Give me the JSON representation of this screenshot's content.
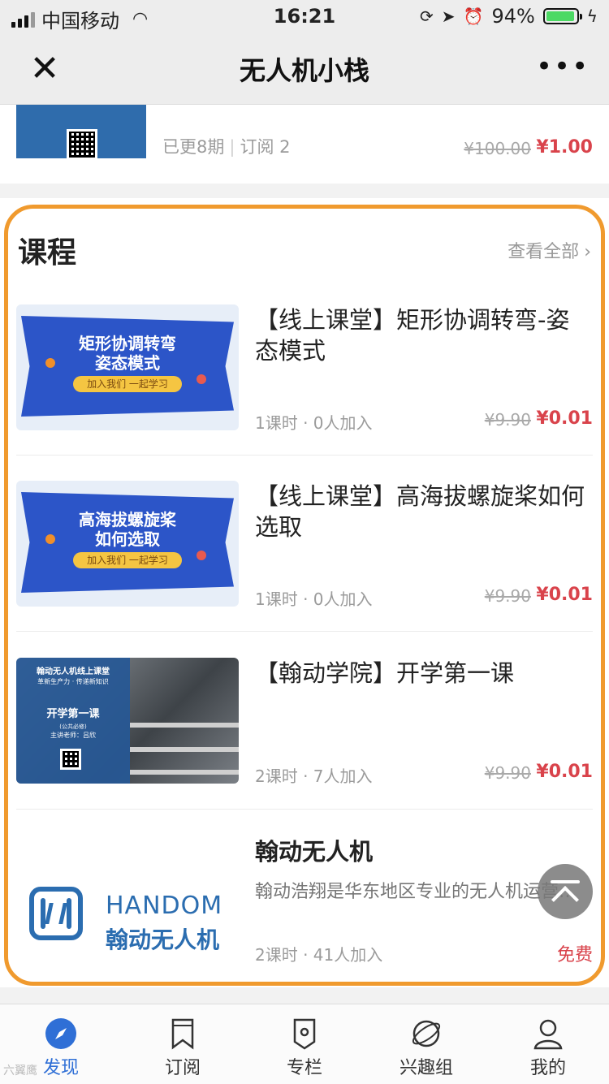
{
  "status_bar": {
    "carrier": "中国移动",
    "time": "16:21",
    "battery": "94%"
  },
  "navbar": {
    "title": "无人机小栈",
    "close_icon": "close-icon",
    "more_icon": "more-icon"
  },
  "prev_item": {
    "meta_updates": "已更8期",
    "meta_subs": "订阅 2",
    "old_price": "¥100.00",
    "price": "¥1.00"
  },
  "section": {
    "title": "课程",
    "see_all": "查看全部"
  },
  "courses": [
    {
      "title": "【线上课堂】矩形协调转弯-姿态模式",
      "thumb_line1": "矩形协调转弯",
      "thumb_line2": "姿态模式",
      "thumb_pill": "加入我们 一起学习",
      "meta": "1课时 · 0人加入",
      "old_price": "¥9.90",
      "price": "¥0.01"
    },
    {
      "title": "【线上课堂】高海拔螺旋桨如何选取",
      "thumb_line1": "高海拔螺旋桨",
      "thumb_line2": "如何选取",
      "thumb_pill": "加入我们 一起学习",
      "meta": "1课时 · 0人加入",
      "old_price": "¥9.90",
      "price": "¥0.01"
    },
    {
      "title": "【翰动学院】开学第一课",
      "thumb_t1": "翰动无人机线上课堂",
      "thumb_t2": "革新生产力 · 传递新知识",
      "thumb_t3": "开学第一课",
      "thumb_t4": "(公共必修)",
      "thumb_t5": "主讲老师：吕欣",
      "meta": "2课时 · 7人加入",
      "old_price": "¥9.90",
      "price": "¥0.01"
    },
    {
      "title": "翰动无人机",
      "desc": "翰动浩翔是华东地区专业的无人机运营服务商",
      "logo_en": "HANDOM",
      "logo_cn": "翰动无人机",
      "meta": "2课时 · 41人加入",
      "price_label": "免费"
    }
  ],
  "tabs": [
    {
      "label": "发现",
      "icon": "compass-icon",
      "active": true
    },
    {
      "label": "订阅",
      "icon": "bookmark-icon"
    },
    {
      "label": "专栏",
      "icon": "column-icon"
    },
    {
      "label": "兴趣组",
      "icon": "planet-icon"
    },
    {
      "label": "我的",
      "icon": "user-icon"
    }
  ],
  "watermark": "六翼鹰",
  "colors": {
    "accent": "#2f6fd6",
    "price_red": "#d9434b",
    "frame_orange": "#f09a2e",
    "banner_blue": "#2c55c8",
    "logo_blue": "#2b6db0"
  }
}
